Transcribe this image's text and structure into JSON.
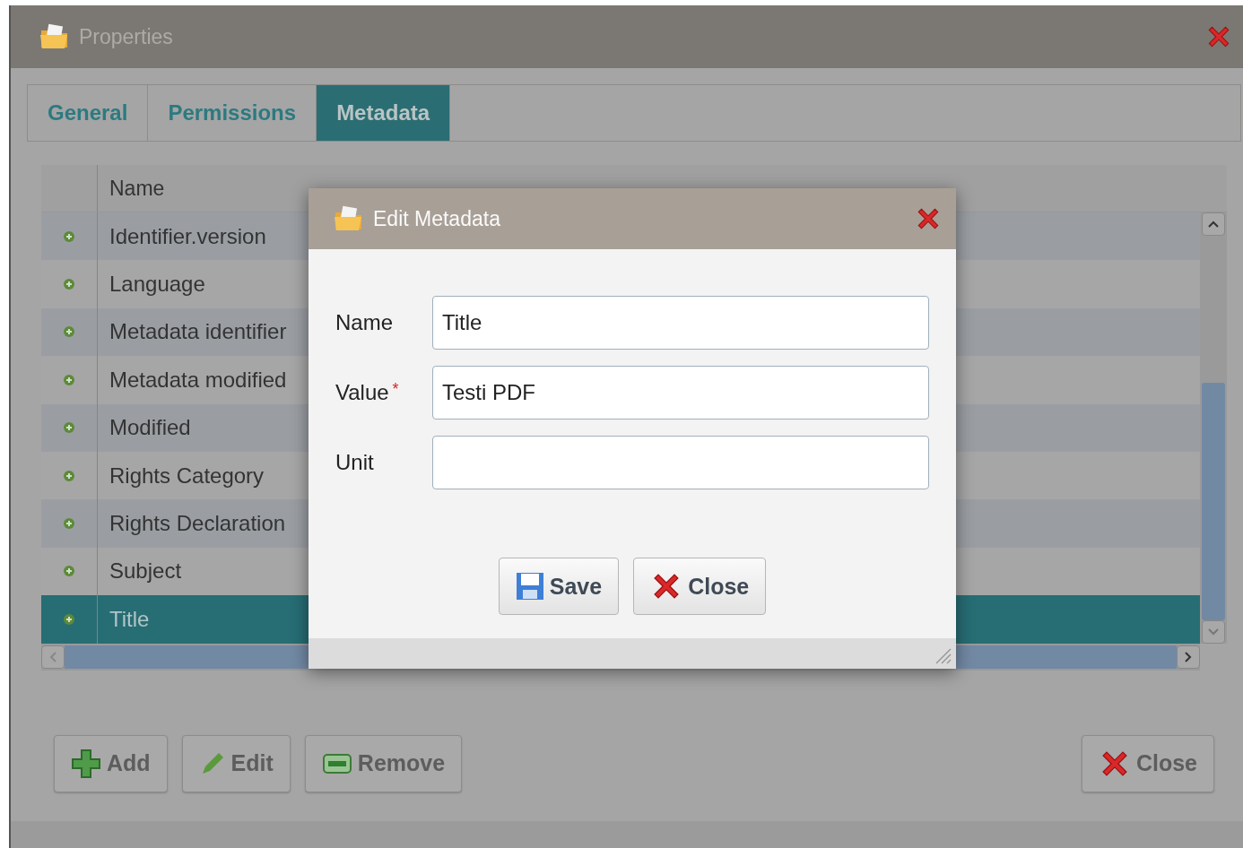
{
  "window": {
    "title": "Properties"
  },
  "tabs": [
    {
      "label": "General",
      "selected": false
    },
    {
      "label": "Permissions",
      "selected": false
    },
    {
      "label": "Metadata",
      "selected": true
    }
  ],
  "table": {
    "columns": [
      "Name"
    ],
    "rows": [
      {
        "name": "Identifier.version",
        "selected": false
      },
      {
        "name": "Language",
        "selected": false
      },
      {
        "name": "Metadata identifier",
        "selected": false
      },
      {
        "name": "Metadata modified",
        "selected": false
      },
      {
        "name": "Modified",
        "selected": false
      },
      {
        "name": "Rights Category",
        "selected": false
      },
      {
        "name": "Rights Declaration",
        "selected": false
      },
      {
        "name": "Subject",
        "selected": false
      },
      {
        "name": "Title",
        "selected": true
      }
    ]
  },
  "buttons": [
    {
      "kind": "add",
      "label": "Add"
    },
    {
      "kind": "edit",
      "label": "Edit"
    },
    {
      "kind": "remove",
      "label": "Remove"
    }
  ],
  "close_button": "Close",
  "dialog": {
    "title": "Edit Metadata",
    "fields": [
      {
        "label": "Name",
        "value": "Title",
        "required": false
      },
      {
        "label": "Value",
        "value": "Testi PDF",
        "required": true
      },
      {
        "label": "Unit",
        "required": false
      }
    ],
    "required_mark": "*",
    "buttons": [
      {
        "kind": "save",
        "label": "Save"
      },
      {
        "kind": "close",
        "label": "Close"
      }
    ]
  }
}
